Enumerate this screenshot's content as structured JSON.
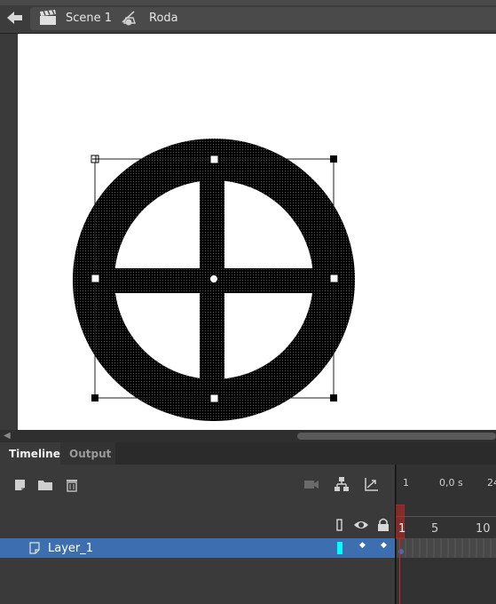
{
  "editbar": {
    "scene_label": "Scene 1",
    "symbol_label": "Roda"
  },
  "panel_tabs": [
    {
      "label": "Timeline",
      "active": true
    },
    {
      "label": "Output",
      "active": false
    }
  ],
  "timeline": {
    "time_ruler": {
      "frame": "1",
      "time": "0,0 s",
      "fps": "24"
    },
    "frame_ruler": [
      "1",
      "5",
      "10"
    ],
    "layers": [
      {
        "name": "Layer_1",
        "selected": true,
        "outline_color": "#00ffff"
      }
    ]
  },
  "colors": {
    "accent_selected_row": "#3d6fb0",
    "playhead": "#c62828",
    "stage": "#ffffff"
  }
}
